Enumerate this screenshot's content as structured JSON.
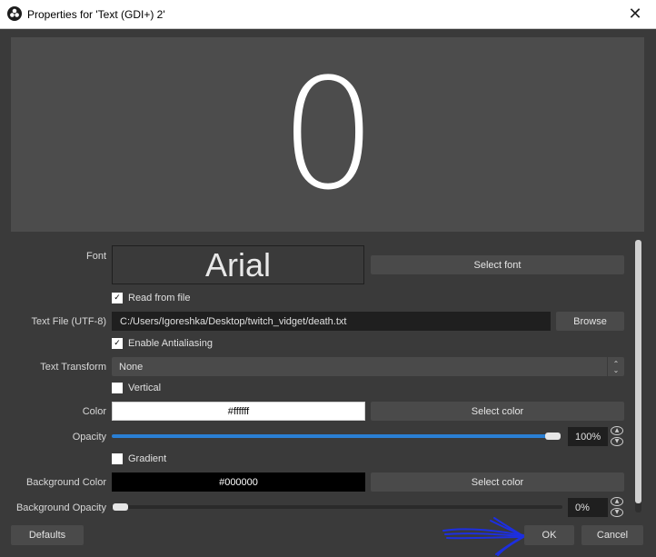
{
  "window": {
    "title": "Properties for 'Text (GDI+) 2'",
    "icon": "obs-logo-icon",
    "close_icon": "close-icon"
  },
  "preview": {
    "text": "0"
  },
  "font": {
    "label": "Font",
    "sample": "Arial",
    "select_button": "Select font"
  },
  "read_from_file": {
    "label": "Read from file",
    "checked": true
  },
  "text_file": {
    "label": "Text File (UTF-8)",
    "value": "C:/Users/Igoreshka/Desktop/twitch_vidget/death.txt",
    "browse_button": "Browse"
  },
  "antialiasing": {
    "label": "Enable Antialiasing",
    "checked": true
  },
  "text_transform": {
    "label": "Text Transform",
    "value": "None"
  },
  "vertical": {
    "label": "Vertical",
    "checked": false
  },
  "color": {
    "label": "Color",
    "value": "#ffffff",
    "swatch": "#ffffff",
    "select_button": "Select color"
  },
  "opacity": {
    "label": "Opacity",
    "value": "100%",
    "fraction": 1.0
  },
  "gradient": {
    "label": "Gradient",
    "checked": false
  },
  "background_color": {
    "label": "Background Color",
    "value": "#000000",
    "swatch": "#000000",
    "select_button": "Select color"
  },
  "background_opacity": {
    "label": "Background Opacity",
    "value": "0%",
    "fraction": 0.0
  },
  "footer": {
    "defaults_button": "Defaults",
    "ok_button": "OK",
    "cancel_button": "Cancel"
  },
  "colors": {
    "accent": "#2a7fd4",
    "annotation": "#1d2fe0"
  }
}
